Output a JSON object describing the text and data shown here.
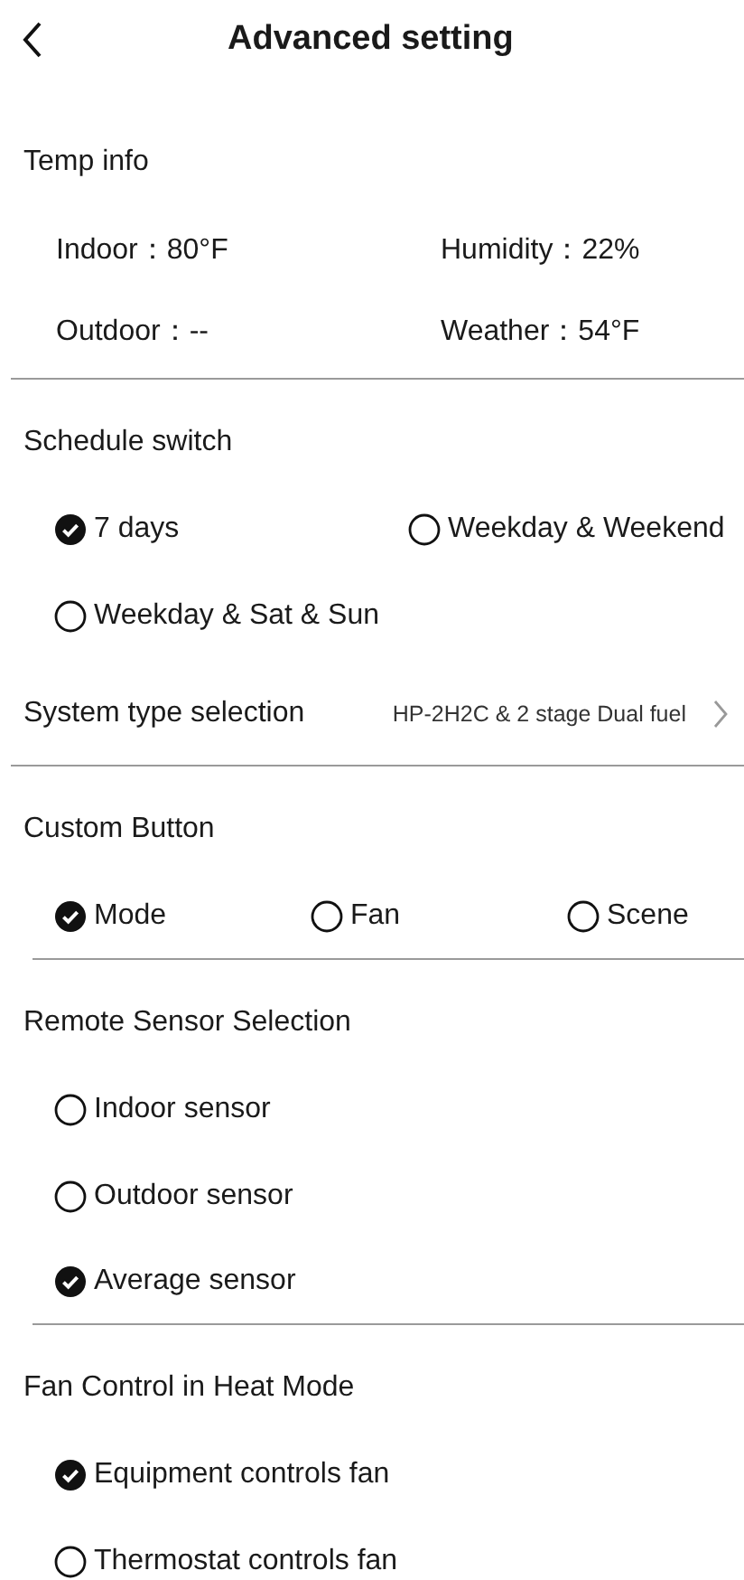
{
  "header": {
    "title": "Advanced setting"
  },
  "sections": [
    {
      "kind": "info",
      "title": "Temp info",
      "items": [
        "Indoor：80°F",
        "Humidity：22%",
        "Outdoor：--",
        "Weather：54°F"
      ]
    },
    {
      "kind": "divider"
    },
    {
      "kind": "radio-pair",
      "title": "Schedule switch",
      "options": [
        {
          "label": "7 days",
          "selected": true
        },
        {
          "label": "Weekday & Weekend",
          "selected": false
        },
        {
          "label": "Weekday & Sat & Sun",
          "selected": false
        }
      ]
    },
    {
      "kind": "link",
      "title": "System type selection",
      "value": "HP-2H2C & 2 stage Dual fuel"
    },
    {
      "kind": "divider"
    },
    {
      "kind": "radio-triple",
      "title": "Custom Button",
      "options": [
        {
          "label": "Mode",
          "selected": true
        },
        {
          "label": "Fan",
          "selected": false
        },
        {
          "label": "Scene",
          "selected": false
        }
      ]
    },
    {
      "kind": "inset-divider"
    },
    {
      "kind": "radio-list",
      "title": "Remote Sensor Selection",
      "options": [
        {
          "label": "Indoor sensor",
          "selected": false
        },
        {
          "label": "Outdoor sensor",
          "selected": false
        },
        {
          "label": "Average sensor",
          "selected": true
        }
      ]
    },
    {
      "kind": "inset-divider"
    },
    {
      "kind": "radio-list",
      "title": "Fan Control in Heat Mode",
      "options": [
        {
          "label": "Equipment controls fan",
          "selected": true
        },
        {
          "label": "Thermostat controls fan",
          "selected": false
        }
      ]
    }
  ]
}
